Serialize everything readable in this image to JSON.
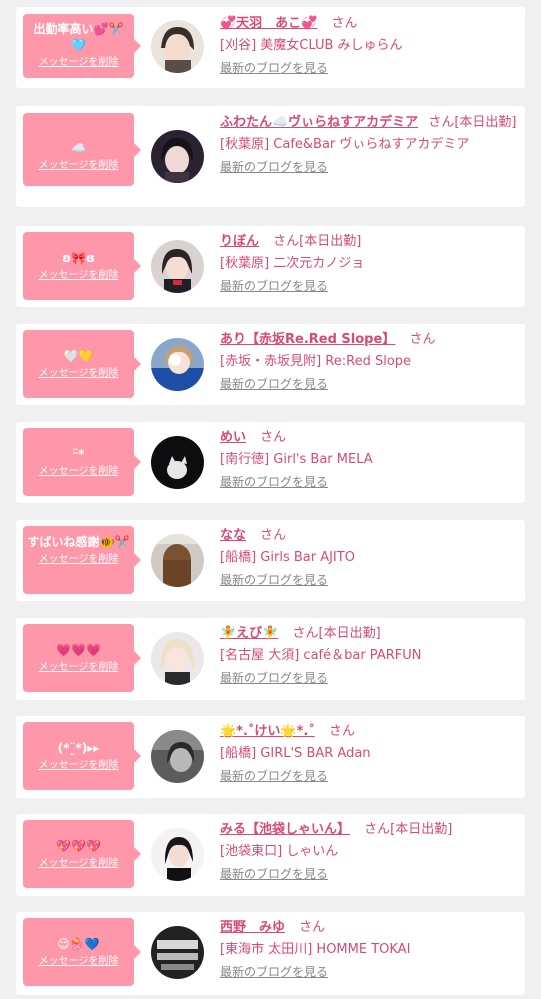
{
  "delete_label": "メッセージを削除",
  "blog_label": "最新のブログを見る",
  "colors": {
    "bubble": "#ff97aa",
    "name": "#d74a77",
    "blog": "#888888",
    "card": "#ffffff",
    "background": "#f0f0f0"
  },
  "items": [
    {
      "message": "出勤率高い💕✂️🩵",
      "name": "💞天羽　あこ💞",
      "suffix": "さん",
      "area": "[刈谷]",
      "shop": "美魔女CLUB みしゅらん",
      "avatar": "avatar-light"
    },
    {
      "message": "☁️",
      "name": "ふわたん☁️ヴぃらねすアカデミア",
      "suffix": "さん[本日出勤]",
      "area": "[秋葉原]",
      "shop": "Cafe&Bar ヴぃらねすアカデミア",
      "avatar": "avatar-dark"
    },
    {
      "message": "ʚ🎀ɞ",
      "name": "りぼん",
      "suffix": "さん[本日出勤]",
      "area": "[秋葉原]",
      "shop": "二次元カノジョ",
      "avatar": "avatar-mid"
    },
    {
      "message": "🤍💛",
      "name": "あり【赤坂Re.Red Slope】",
      "suffix": "さん",
      "area": "[赤坂・赤坂見附]",
      "shop": "Re:Red Slope",
      "avatar": "avatar-blue"
    },
    {
      "message": "ᵕ̈*",
      "name": "めい",
      "suffix": "さん",
      "area": "[南行徳]",
      "shop": "Girl's Bar MELA",
      "avatar": "avatar-black"
    },
    {
      "message": "すばいね感謝🐠✂️",
      "name": "なな",
      "suffix": "さん",
      "area": "[船橋]",
      "shop": "Girls Bar AJITO",
      "avatar": "avatar-brown"
    },
    {
      "message": "💗💗💗",
      "name": "🧚えび🧚",
      "suffix": "さん[本日出勤]",
      "area": "[名古屋 大須]",
      "shop": "café＆bar PARFUN",
      "avatar": "avatar-blonde"
    },
    {
      "message": "(*¨̮*)▸▸",
      "name": "🌟*.˚けい🌟*.˚",
      "suffix": "さん",
      "area": "[船橋]",
      "shop": "GIRL'S BAR Adan",
      "avatar": "avatar-gray"
    },
    {
      "message": "💖💖💖",
      "name": "みる【池袋しゃいん】",
      "suffix": "さん[本日出勤]",
      "area": "[池袋東口]",
      "shop": "しゃいん",
      "avatar": "avatar-white"
    },
    {
      "message": "😌🪼💙",
      "name": "西野　みゆ",
      "suffix": "さん",
      "area": "[東海市 太田川]",
      "shop": "HOMME TOKAI",
      "avatar": "avatar-mono"
    }
  ]
}
